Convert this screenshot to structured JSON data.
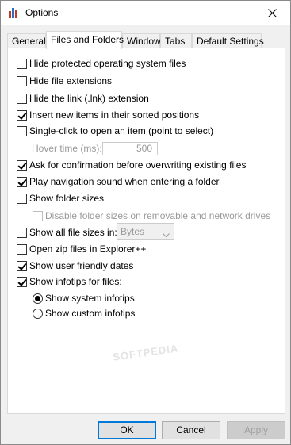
{
  "window": {
    "title": "Options"
  },
  "tabs": [
    {
      "label": "General"
    },
    {
      "label": "Files and Folders"
    },
    {
      "label": "Window"
    },
    {
      "label": "Tabs"
    },
    {
      "label": "Default Settings"
    }
  ],
  "options": {
    "hide_protected": {
      "label": "Hide protected operating system files",
      "checked": false
    },
    "hide_extensions": {
      "label": "Hide file extensions",
      "checked": false
    },
    "hide_lnk": {
      "label": "Hide the link (.lnk) extension",
      "checked": false
    },
    "insert_sorted": {
      "label": "Insert new items in their sorted positions",
      "checked": true
    },
    "single_click": {
      "label": "Single-click to open an item (point to select)",
      "checked": false
    },
    "hover_time": {
      "label": "Hover time (ms):",
      "value": "500"
    },
    "confirm_overwrite": {
      "label": "Ask for confirmation before overwriting existing files",
      "checked": true
    },
    "nav_sound": {
      "label": "Play navigation sound when entering a folder",
      "checked": true
    },
    "show_folder_sizes": {
      "label": "Show folder sizes",
      "checked": false
    },
    "disable_removable": {
      "label": "Disable folder sizes on removable and network drives",
      "checked": false
    },
    "show_all_sizes": {
      "label": "Show all file sizes in:",
      "checked": false,
      "unit": "Bytes"
    },
    "open_zip": {
      "label": "Open zip files in Explorer++",
      "checked": false
    },
    "friendly_dates": {
      "label": "Show user friendly dates",
      "checked": true
    },
    "infotips": {
      "label": "Show infotips for files:",
      "checked": true
    },
    "system_infotips": {
      "label": "Show system infotips",
      "selected": true
    },
    "custom_infotips": {
      "label": "Show custom infotips",
      "selected": false
    }
  },
  "buttons": {
    "ok": "OK",
    "cancel": "Cancel",
    "apply": "Apply"
  },
  "watermark": "SOFTPEDIA",
  "colors": {
    "accent": "#0078d7",
    "disabled": "#9a9a9a"
  }
}
